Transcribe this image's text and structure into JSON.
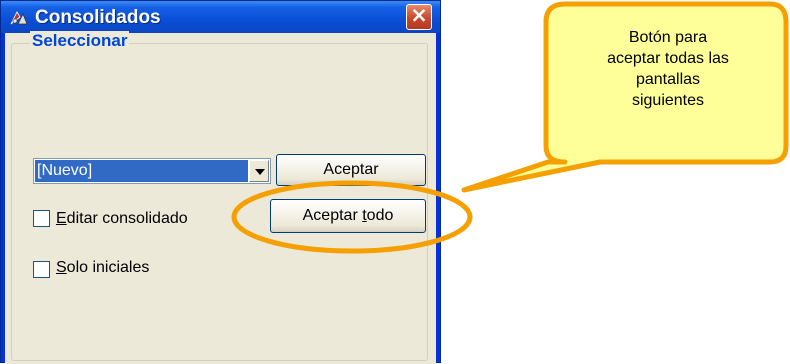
{
  "window": {
    "title": "Consolidados",
    "close_label": "×"
  },
  "groupbox": {
    "legend": "Seleccionar"
  },
  "combo": {
    "value": "[Nuevo]"
  },
  "buttons": {
    "aceptar": {
      "prefix": "",
      "mnemonic": "",
      "rest": "Aceptar"
    },
    "aceptar_todo": {
      "prefix": "Aceptar ",
      "mnemonic": "t",
      "rest": "odo"
    }
  },
  "checkboxes": [
    {
      "mnemonic": "E",
      "rest": "ditar consolidado",
      "checked": false
    },
    {
      "mnemonic": "S",
      "rest": "olo iniciales",
      "checked": false
    }
  ],
  "callout": {
    "lines": [
      "Botón para",
      "aceptar todas las",
      "pantallas",
      "siguientes"
    ],
    "fill_color": "#ffff99",
    "stroke_color": "#f5a000"
  }
}
